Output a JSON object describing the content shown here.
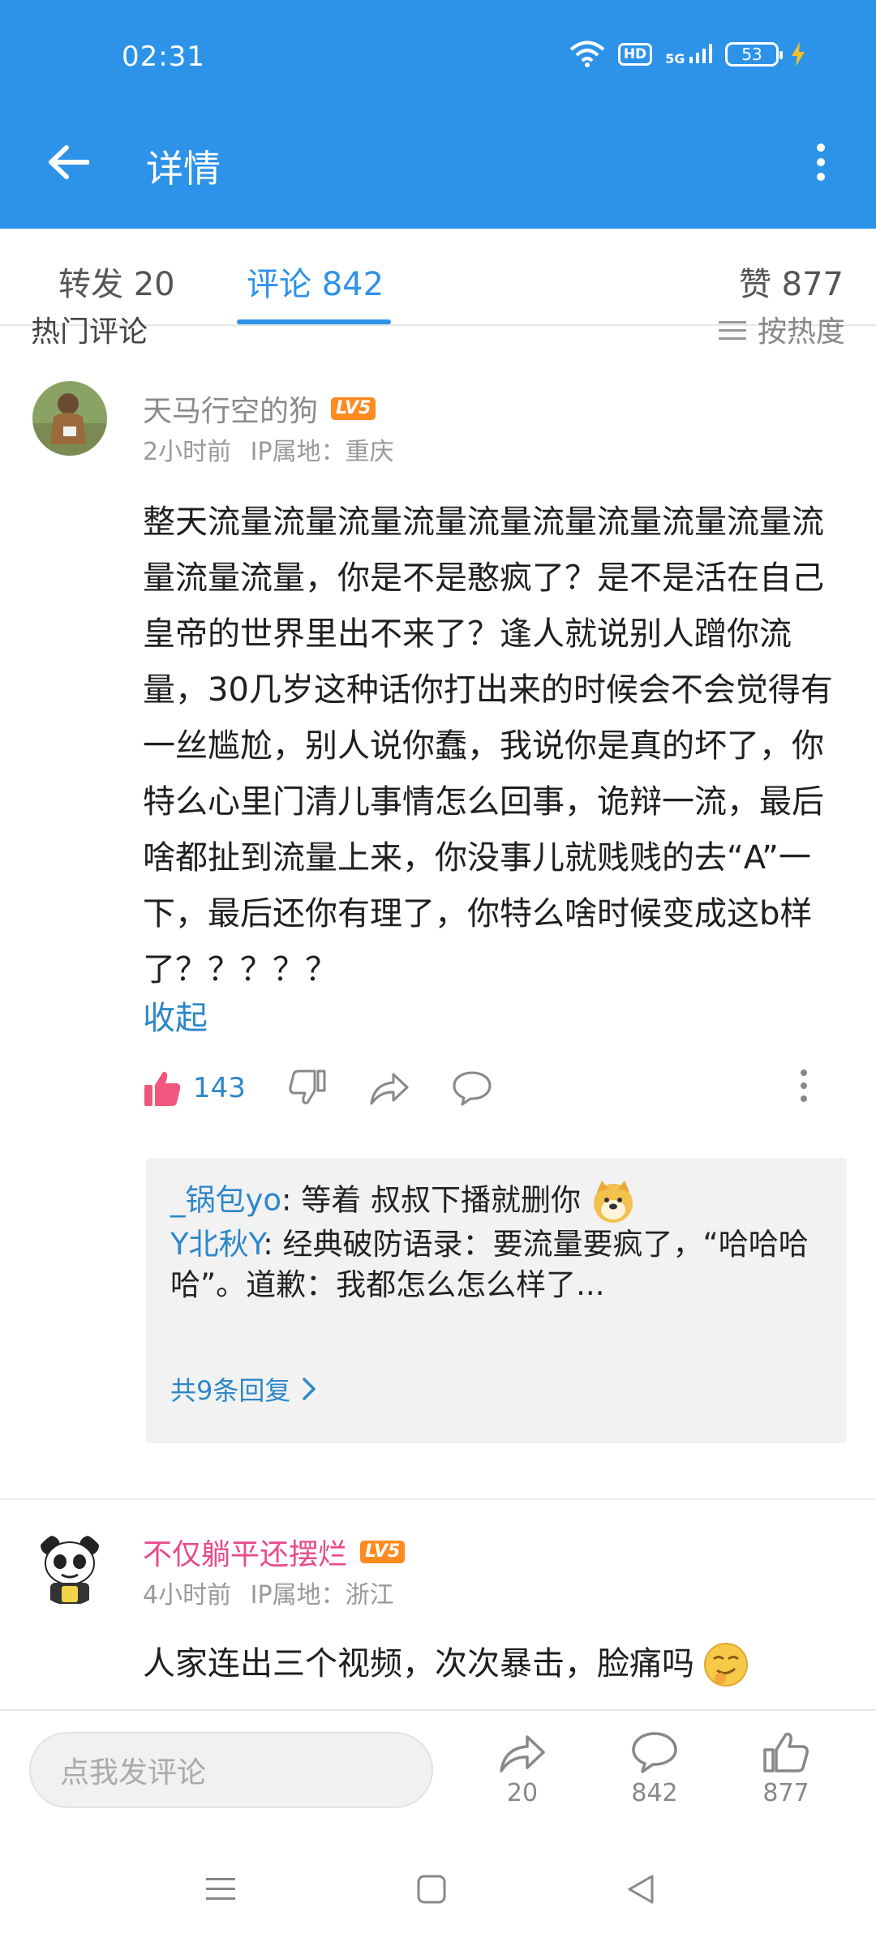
{
  "status": {
    "time": "02:31",
    "network": "5G",
    "hd": "HD",
    "battery": "53"
  },
  "header": {
    "title": "详情"
  },
  "tabs": {
    "forward": "转发 20",
    "comment": "评论 842",
    "like": "赞 877"
  },
  "section": {
    "title": "热门评论",
    "sort_label": "按热度"
  },
  "comments": [
    {
      "username": "天马行空的狗",
      "level": "LV5",
      "time": "2小时前",
      "ip": "IP属地：重庆",
      "text": "整天流量流量流量流量流量流量流量流量流量流量流量流量，你是不是憨疯了？是不是活在自己皇帝的世界里出不来了？逢人就说别人蹭你流量，30几岁这种话你打出来的时候会不会觉得有一丝尴尬，别人说你蠢，我说你是真的坏了，你特么心里门清儿事情怎么回事，诡辩一流，最后啥都扯到流量上来，你没事儿就贱贱的去“A”一下，最后还你有理了，你特么啥时候变成这b样了？？？？？",
      "collapse": "收起",
      "likes": "143",
      "replies": [
        {
          "user": "_锅包yo",
          "text": ": 等着 叔叔下播就删你"
        },
        {
          "user": "Y北秋Y",
          "text": ": 经典破防语录：要流量要疯了，“哈哈哈哈”。道歉：我都怎么怎么样了..."
        }
      ],
      "reply_total": "共9条回复"
    },
    {
      "username": "不仅躺平还摆烂",
      "level": "LV5",
      "time": "4小时前",
      "ip": "IP属地：浙江",
      "text": "人家连出三个视频，次次暴击，脸痛吗"
    }
  ],
  "bottom": {
    "input_placeholder": "点我发评论",
    "forward_count": "20",
    "comment_count": "842",
    "like_count": "877"
  },
  "colors": {
    "primary": "#2d93e9",
    "link": "#2d87c8",
    "like": "#f0567e",
    "pink_name": "#e84a8a",
    "level": "#ff8a1f"
  }
}
